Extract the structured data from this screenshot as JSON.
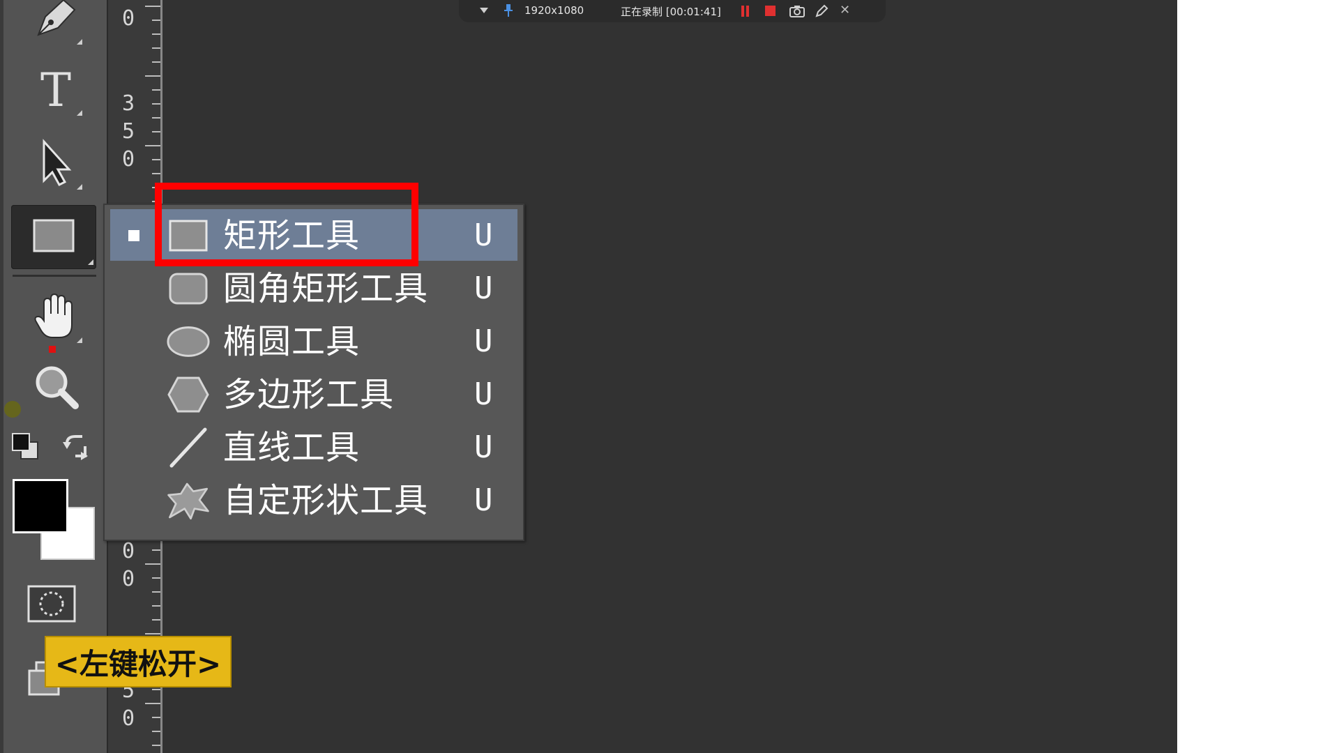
{
  "recording_bar": {
    "resolution": "1920x1080",
    "status": "正在录制 [00:01:41]",
    "close_glyph": "✕"
  },
  "ruler": {
    "numbers": [
      "0",
      "3",
      "5",
      "0",
      "0",
      "0",
      "5",
      "0"
    ]
  },
  "tools": {
    "pen": "pen-icon",
    "type": "type-icon",
    "type_glyph": "T",
    "path_select": "arrow-cursor-icon",
    "rectangle": "rectangle-icon",
    "hand": "hand-icon",
    "zoom": "zoom-icon",
    "quick_mask": "quick-mask-icon",
    "screen_mode": "screen-mode-icon"
  },
  "colors": {
    "foreground": "#000000",
    "background": "#ffffff",
    "menu_selected": "#6e7e96",
    "highlight": "#ff0000",
    "caption_bg": "#e6b817"
  },
  "shape_menu": {
    "items": [
      {
        "label": "矩形工具",
        "shortcut": "U",
        "icon": "rectangle-icon",
        "selected": true
      },
      {
        "label": "圆角矩形工具",
        "shortcut": "U",
        "icon": "rounded-rectangle-icon",
        "selected": false
      },
      {
        "label": "椭圆工具",
        "shortcut": "U",
        "icon": "ellipse-icon",
        "selected": false
      },
      {
        "label": "多边形工具",
        "shortcut": "U",
        "icon": "polygon-icon",
        "selected": false
      },
      {
        "label": "直线工具",
        "shortcut": "U",
        "icon": "line-icon",
        "selected": false
      },
      {
        "label": "自定形状工具",
        "shortcut": "U",
        "icon": "custom-shape-icon",
        "selected": false
      }
    ]
  },
  "caption": "<左键松开>"
}
